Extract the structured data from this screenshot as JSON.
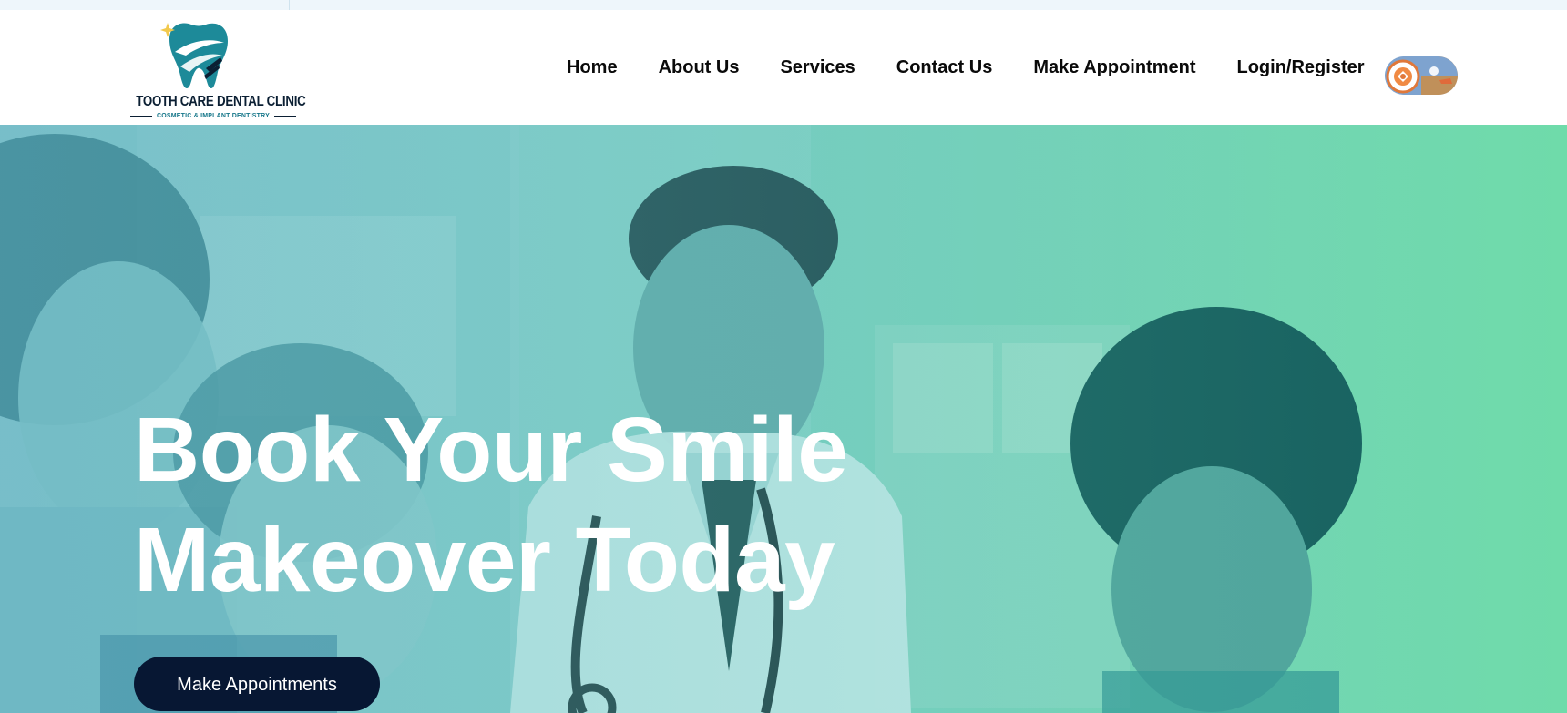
{
  "brand": {
    "name": "TOOTH CARE DENTAL CLINIC",
    "tagline": "COSMETIC & IMPLANT DENTISTRY",
    "colors": {
      "teal": "#1d8a99",
      "navy": "#0b1f33",
      "star": "#f2c94c"
    }
  },
  "nav": {
    "items": [
      {
        "label": "Home"
      },
      {
        "label": "About Us"
      },
      {
        "label": "Services"
      },
      {
        "label": "Contact Us"
      },
      {
        "label": "Make Appointment"
      },
      {
        "label": "Login/Register"
      }
    ],
    "avatar_icon": "bot-avatar-icon"
  },
  "hero": {
    "title_line1": "Book Your Smile",
    "title_line2": "Makeover Today",
    "cta_label": "Make Appointments",
    "overlay_colors": [
      "#7cc2cc",
      "#6fdbaa"
    ],
    "cta_color": "#071733"
  }
}
